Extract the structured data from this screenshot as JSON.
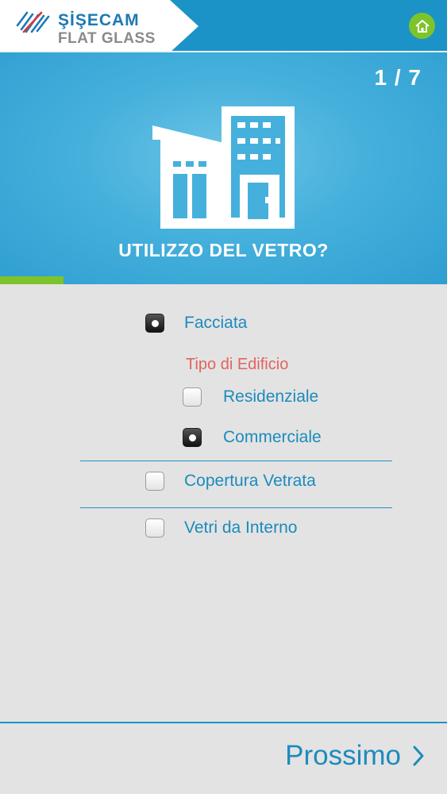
{
  "header": {
    "brand_line1": "ŞİŞECAM",
    "brand_line2": "FLAT GLASS",
    "home_icon": "home-icon",
    "accent_color": "#1c93c6",
    "home_color": "#7dc42a"
  },
  "hero": {
    "counter": "1 / 7",
    "title": "UTILIZZO DEL VETRO?",
    "illustration": "buildings-icon",
    "progress_fraction": 0.1428
  },
  "options": {
    "facade": {
      "label": "Facciata",
      "checked": true
    },
    "building_type": {
      "heading": "Tipo di Edificio",
      "residential": {
        "label": "Residenziale",
        "checked": false
      },
      "commercial": {
        "label": "Commerciale",
        "checked": true
      }
    },
    "glass_roof": {
      "label": "Copertura Vetrata",
      "checked": false
    },
    "interior": {
      "label": "Vetri da Interno",
      "checked": false
    }
  },
  "footer": {
    "next_label": "Prossimo",
    "next_icon": "chevron-right-icon"
  }
}
